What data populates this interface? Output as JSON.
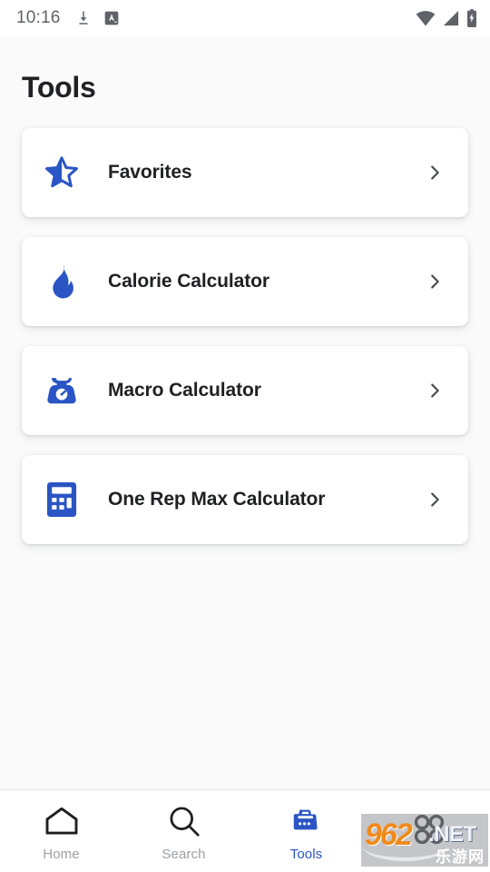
{
  "status_bar": {
    "time": "10:16",
    "left_icons": [
      "download-icon",
      "translate-a-icon"
    ],
    "right_icons": [
      "wifi-icon",
      "cellular-signal-icon",
      "battery-charging-icon"
    ],
    "icon_color": "#5f6368"
  },
  "header": {
    "title": "Tools"
  },
  "theme": {
    "accent": "#2b55c4",
    "text": "#202124",
    "muted": "#9aa0a6",
    "card_bg": "#ffffff",
    "page_bg": "#fafafa"
  },
  "tools": [
    {
      "label": "Favorites",
      "icon": "star-half-icon",
      "chevron": "chevron-right-icon"
    },
    {
      "label": "Calorie Calculator",
      "icon": "flame-icon",
      "chevron": "chevron-right-icon"
    },
    {
      "label": "Macro Calculator",
      "icon": "kitchen-scale-icon",
      "chevron": "chevron-right-icon"
    },
    {
      "label": "One Rep Max Calculator",
      "icon": "calculator-icon",
      "chevron": "chevron-right-icon"
    }
  ],
  "bottom_nav": [
    {
      "label": "Home",
      "icon": "home-icon",
      "active": false
    },
    {
      "label": "Search",
      "icon": "search-icon",
      "active": false
    },
    {
      "label": "Tools",
      "icon": "toolbox-icon",
      "active": true
    },
    {
      "label": "",
      "icon": "more-grid-icon",
      "active": false
    }
  ],
  "watermark": {
    "number": "962",
    "tld": ".NET",
    "chinese": "乐游网"
  }
}
